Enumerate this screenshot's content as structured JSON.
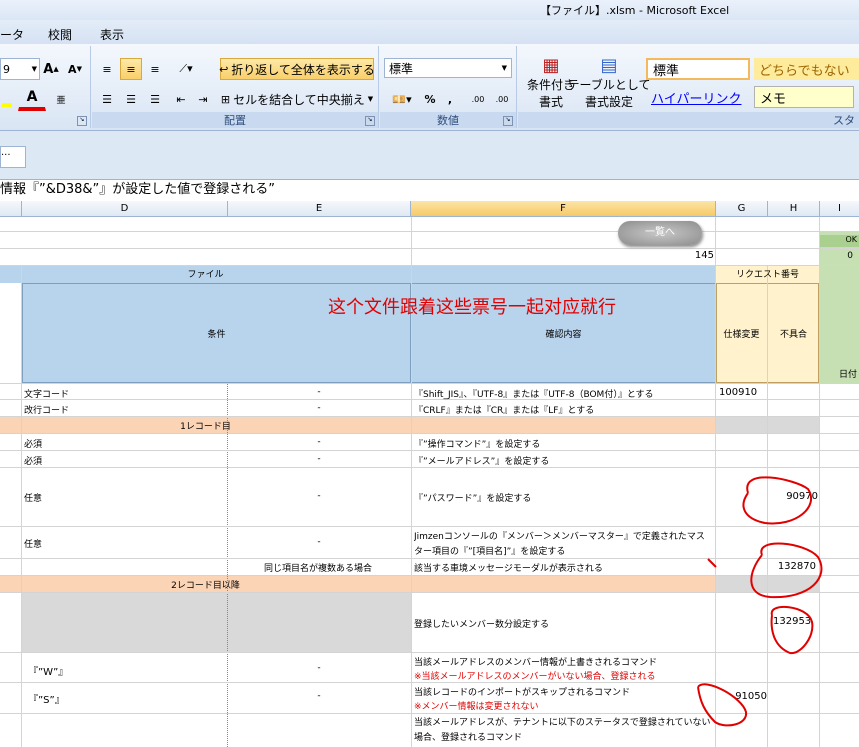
{
  "window": {
    "title": "【ファイル】.xlsm - Microsoft Excel"
  },
  "tabs": [
    "ータ",
    "校閲",
    "表示"
  ],
  "ribbon": {
    "font_size": "9",
    "grow_font": "A",
    "shrink_font": "A",
    "font_color": "A",
    "wrap_text": "折り返して全体を表示する",
    "merge_center": "セルを結合して中央揃え",
    "alignment_label": "配置",
    "number_format": "標準",
    "percent": "%",
    "comma": ",",
    "inc_decimal": ".00",
    "dec_decimal": ".00",
    "number_label": "数値",
    "cond_format": [
      "条件付き",
      "書式"
    ],
    "table_format": [
      "テーブルとして",
      "書式設定"
    ],
    "styles": {
      "normal": "標準",
      "neutral": "どちらでもない",
      "hyperlink": "ハイパーリンク",
      "memo": "メモ"
    },
    "styles_label": "スタ"
  },
  "formula_bar": {
    "namebox": "...",
    "formula": "情報『”&D38&”』が設定した値で登録される”"
  },
  "columns": [
    "D",
    "E",
    "F",
    "G",
    "H",
    "I"
  ],
  "sheet": {
    "button_list": "一覧へ",
    "count": "145",
    "ok_label": "OK",
    "zero": "0",
    "date_label": "日付",
    "hdr_file": "ファイル",
    "hdr_request": "リクエスト番号",
    "hdr_condition": "条件",
    "hdr_check": "確認内容",
    "hdr_spec": "仕様変更",
    "hdr_bug": "不具合",
    "annotation": "这个文件跟着这些票号一起对应就行",
    "rows": [
      {
        "d": "文字コード",
        "e": "-",
        "f": "『Shift_JIS』、『UTF-8』または『UTF-8（BOM付）』とする",
        "g": "100910",
        "h": ""
      },
      {
        "d": "改行コード",
        "e": "-",
        "f": "『CRLF』または『CR』または『LF』とする",
        "g": "",
        "h": ""
      },
      {
        "section": "1レコード目"
      },
      {
        "d": "必須",
        "e": "-",
        "f": "『”操作コマンド”』を設定する",
        "g": "",
        "h": ""
      },
      {
        "d": "必須",
        "e": "-",
        "f": "『”メールアドレス”』を設定する",
        "g": "",
        "h": ""
      },
      {
        "d": "任意",
        "e": "-",
        "f": "『”パスワード”』を設定する",
        "g": "",
        "h": "90970"
      },
      {
        "d": "任意",
        "e": "-",
        "f": "Jimzenコンソールの『メンバー＞メンバーマスター』で定義されたマス",
        "f2": "ター項目の『”[項目名]”』を設定する",
        "g": "",
        "h": ""
      },
      {
        "d": "",
        "e": "同じ項目名が複数ある場合",
        "f": "該当する車境メッセージモーダルが表示される",
        "g": "",
        "h": "132870"
      },
      {
        "section": "2レコード目以降"
      },
      {
        "d": "",
        "e": "",
        "f": "登録したいメンバー数分設定する",
        "g": "",
        "h": "132953"
      },
      {
        "d": "『”W”』",
        "e": "-",
        "f": "当該メールアドレスのメンバー情報が上書きされるコマンド",
        "f2": "※当該メールアドレスのメンバーがいない場合、登録される",
        "g": "",
        "h": ""
      },
      {
        "d": "『”S”』",
        "e": "-",
        "f": "当該レコードのインポートがスキップされるコマンド",
        "f2": "※メンバー情報は変更されない",
        "g": "91050",
        "h": ""
      },
      {
        "d": "",
        "e": "",
        "f": "当該メールアドレスが、テナントに以下のステータスで登録されていない",
        "f2": "場合、登録されるコマンド",
        "g": "",
        "h": ""
      }
    ]
  },
  "colors": {
    "header_blue": "#b8d3ec",
    "section_orange": "#fbd4b5",
    "yellow": "#fff2cc",
    "green": "#c6e0b4",
    "annotation_red": "#e00000"
  }
}
